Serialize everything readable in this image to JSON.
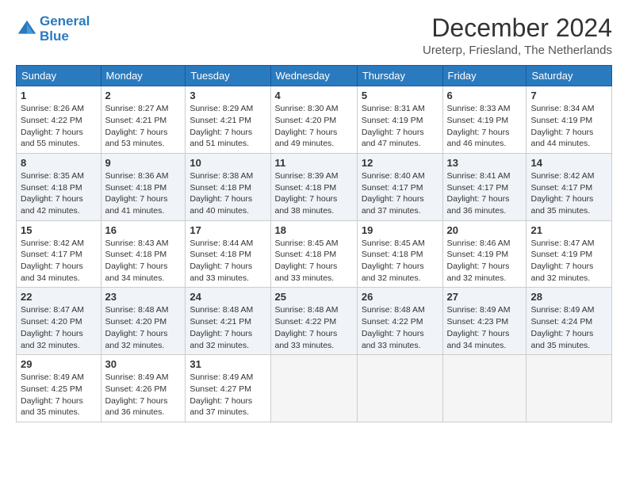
{
  "header": {
    "logo_line1": "General",
    "logo_line2": "Blue",
    "title": "December 2024",
    "subtitle": "Ureterp, Friesland, The Netherlands"
  },
  "days_of_week": [
    "Sunday",
    "Monday",
    "Tuesday",
    "Wednesday",
    "Thursday",
    "Friday",
    "Saturday"
  ],
  "weeks": [
    [
      {
        "day": "1",
        "sunrise": "Sunrise: 8:26 AM",
        "sunset": "Sunset: 4:22 PM",
        "daylight": "Daylight: 7 hours and 55 minutes."
      },
      {
        "day": "2",
        "sunrise": "Sunrise: 8:27 AM",
        "sunset": "Sunset: 4:21 PM",
        "daylight": "Daylight: 7 hours and 53 minutes."
      },
      {
        "day": "3",
        "sunrise": "Sunrise: 8:29 AM",
        "sunset": "Sunset: 4:21 PM",
        "daylight": "Daylight: 7 hours and 51 minutes."
      },
      {
        "day": "4",
        "sunrise": "Sunrise: 8:30 AM",
        "sunset": "Sunset: 4:20 PM",
        "daylight": "Daylight: 7 hours and 49 minutes."
      },
      {
        "day": "5",
        "sunrise": "Sunrise: 8:31 AM",
        "sunset": "Sunset: 4:19 PM",
        "daylight": "Daylight: 7 hours and 47 minutes."
      },
      {
        "day": "6",
        "sunrise": "Sunrise: 8:33 AM",
        "sunset": "Sunset: 4:19 PM",
        "daylight": "Daylight: 7 hours and 46 minutes."
      },
      {
        "day": "7",
        "sunrise": "Sunrise: 8:34 AM",
        "sunset": "Sunset: 4:19 PM",
        "daylight": "Daylight: 7 hours and 44 minutes."
      }
    ],
    [
      {
        "day": "8",
        "sunrise": "Sunrise: 8:35 AM",
        "sunset": "Sunset: 4:18 PM",
        "daylight": "Daylight: 7 hours and 42 minutes."
      },
      {
        "day": "9",
        "sunrise": "Sunrise: 8:36 AM",
        "sunset": "Sunset: 4:18 PM",
        "daylight": "Daylight: 7 hours and 41 minutes."
      },
      {
        "day": "10",
        "sunrise": "Sunrise: 8:38 AM",
        "sunset": "Sunset: 4:18 PM",
        "daylight": "Daylight: 7 hours and 40 minutes."
      },
      {
        "day": "11",
        "sunrise": "Sunrise: 8:39 AM",
        "sunset": "Sunset: 4:18 PM",
        "daylight": "Daylight: 7 hours and 38 minutes."
      },
      {
        "day": "12",
        "sunrise": "Sunrise: 8:40 AM",
        "sunset": "Sunset: 4:17 PM",
        "daylight": "Daylight: 7 hours and 37 minutes."
      },
      {
        "day": "13",
        "sunrise": "Sunrise: 8:41 AM",
        "sunset": "Sunset: 4:17 PM",
        "daylight": "Daylight: 7 hours and 36 minutes."
      },
      {
        "day": "14",
        "sunrise": "Sunrise: 8:42 AM",
        "sunset": "Sunset: 4:17 PM",
        "daylight": "Daylight: 7 hours and 35 minutes."
      }
    ],
    [
      {
        "day": "15",
        "sunrise": "Sunrise: 8:42 AM",
        "sunset": "Sunset: 4:17 PM",
        "daylight": "Daylight: 7 hours and 34 minutes."
      },
      {
        "day": "16",
        "sunrise": "Sunrise: 8:43 AM",
        "sunset": "Sunset: 4:18 PM",
        "daylight": "Daylight: 7 hours and 34 minutes."
      },
      {
        "day": "17",
        "sunrise": "Sunrise: 8:44 AM",
        "sunset": "Sunset: 4:18 PM",
        "daylight": "Daylight: 7 hours and 33 minutes."
      },
      {
        "day": "18",
        "sunrise": "Sunrise: 8:45 AM",
        "sunset": "Sunset: 4:18 PM",
        "daylight": "Daylight: 7 hours and 33 minutes."
      },
      {
        "day": "19",
        "sunrise": "Sunrise: 8:45 AM",
        "sunset": "Sunset: 4:18 PM",
        "daylight": "Daylight: 7 hours and 32 minutes."
      },
      {
        "day": "20",
        "sunrise": "Sunrise: 8:46 AM",
        "sunset": "Sunset: 4:19 PM",
        "daylight": "Daylight: 7 hours and 32 minutes."
      },
      {
        "day": "21",
        "sunrise": "Sunrise: 8:47 AM",
        "sunset": "Sunset: 4:19 PM",
        "daylight": "Daylight: 7 hours and 32 minutes."
      }
    ],
    [
      {
        "day": "22",
        "sunrise": "Sunrise: 8:47 AM",
        "sunset": "Sunset: 4:20 PM",
        "daylight": "Daylight: 7 hours and 32 minutes."
      },
      {
        "day": "23",
        "sunrise": "Sunrise: 8:48 AM",
        "sunset": "Sunset: 4:20 PM",
        "daylight": "Daylight: 7 hours and 32 minutes."
      },
      {
        "day": "24",
        "sunrise": "Sunrise: 8:48 AM",
        "sunset": "Sunset: 4:21 PM",
        "daylight": "Daylight: 7 hours and 32 minutes."
      },
      {
        "day": "25",
        "sunrise": "Sunrise: 8:48 AM",
        "sunset": "Sunset: 4:22 PM",
        "daylight": "Daylight: 7 hours and 33 minutes."
      },
      {
        "day": "26",
        "sunrise": "Sunrise: 8:48 AM",
        "sunset": "Sunset: 4:22 PM",
        "daylight": "Daylight: 7 hours and 33 minutes."
      },
      {
        "day": "27",
        "sunrise": "Sunrise: 8:49 AM",
        "sunset": "Sunset: 4:23 PM",
        "daylight": "Daylight: 7 hours and 34 minutes."
      },
      {
        "day": "28",
        "sunrise": "Sunrise: 8:49 AM",
        "sunset": "Sunset: 4:24 PM",
        "daylight": "Daylight: 7 hours and 35 minutes."
      }
    ],
    [
      {
        "day": "29",
        "sunrise": "Sunrise: 8:49 AM",
        "sunset": "Sunset: 4:25 PM",
        "daylight": "Daylight: 7 hours and 35 minutes."
      },
      {
        "day": "30",
        "sunrise": "Sunrise: 8:49 AM",
        "sunset": "Sunset: 4:26 PM",
        "daylight": "Daylight: 7 hours and 36 minutes."
      },
      {
        "day": "31",
        "sunrise": "Sunrise: 8:49 AM",
        "sunset": "Sunset: 4:27 PM",
        "daylight": "Daylight: 7 hours and 37 minutes."
      },
      null,
      null,
      null,
      null
    ]
  ]
}
